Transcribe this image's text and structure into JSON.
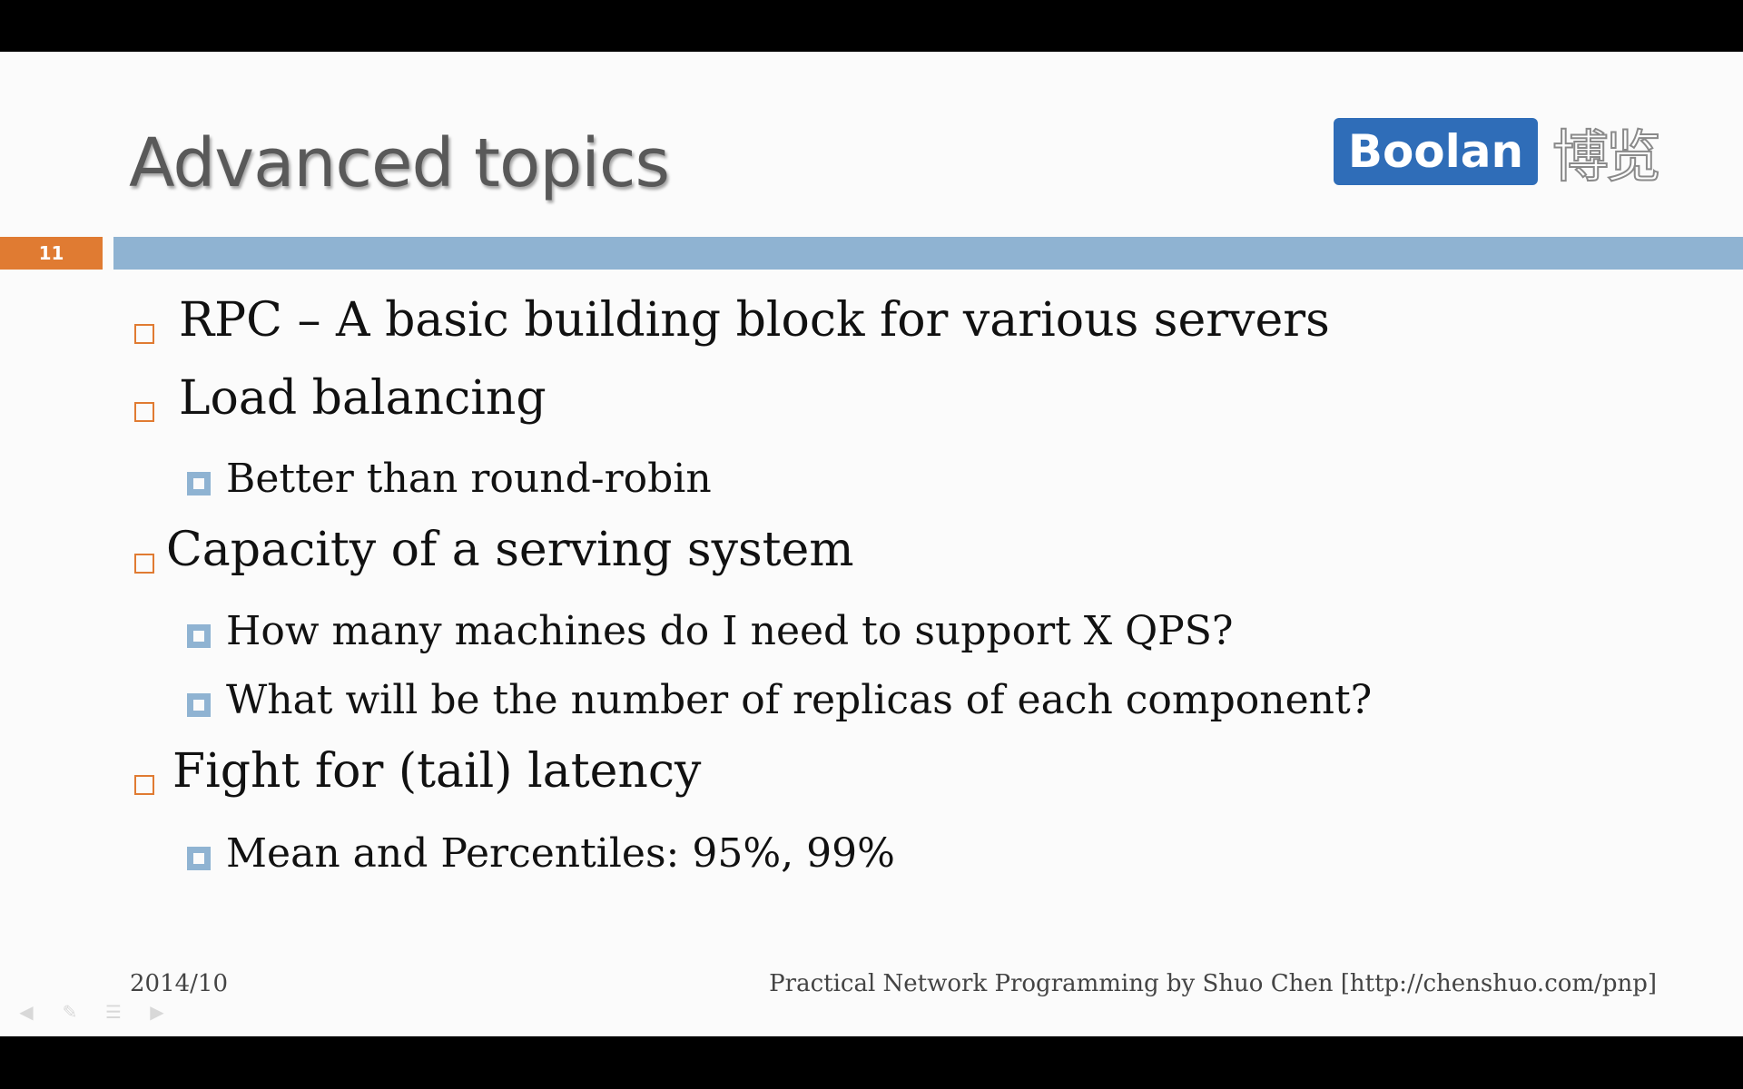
{
  "slide": {
    "title": "Advanced topics",
    "slide_number": "11",
    "logo": {
      "label": "Boolan",
      "cjk": "博览",
      "color": "#2f6db8"
    },
    "accent_colors": {
      "orange": "#e07b32",
      "blue": "#8fb3d2"
    },
    "bullets": [
      {
        "level": 1,
        "text": "RPC – A basic building block for various servers"
      },
      {
        "level": 1,
        "text": "Load balancing"
      },
      {
        "level": 2,
        "text": "Better than round-robin"
      },
      {
        "level": 1,
        "text": " Capacity of a serving system"
      },
      {
        "level": 2,
        "text": "How many machines do I need to support X QPS?"
      },
      {
        "level": 2,
        "text": "What will be the number of replicas of each component?"
      },
      {
        "level": 1,
        "text": " Fight for (tail) latency"
      },
      {
        "level": 2,
        "text": "Mean and Percentiles: 95%, 99%"
      }
    ],
    "footer": {
      "date": "2014/10",
      "credit": "Practical Network Programming by Shuo Chen [http://chenshuo.com/pnp]"
    },
    "nav_icons": [
      "previous-slide-icon",
      "pen-icon",
      "menu-icon",
      "next-slide-icon"
    ]
  }
}
